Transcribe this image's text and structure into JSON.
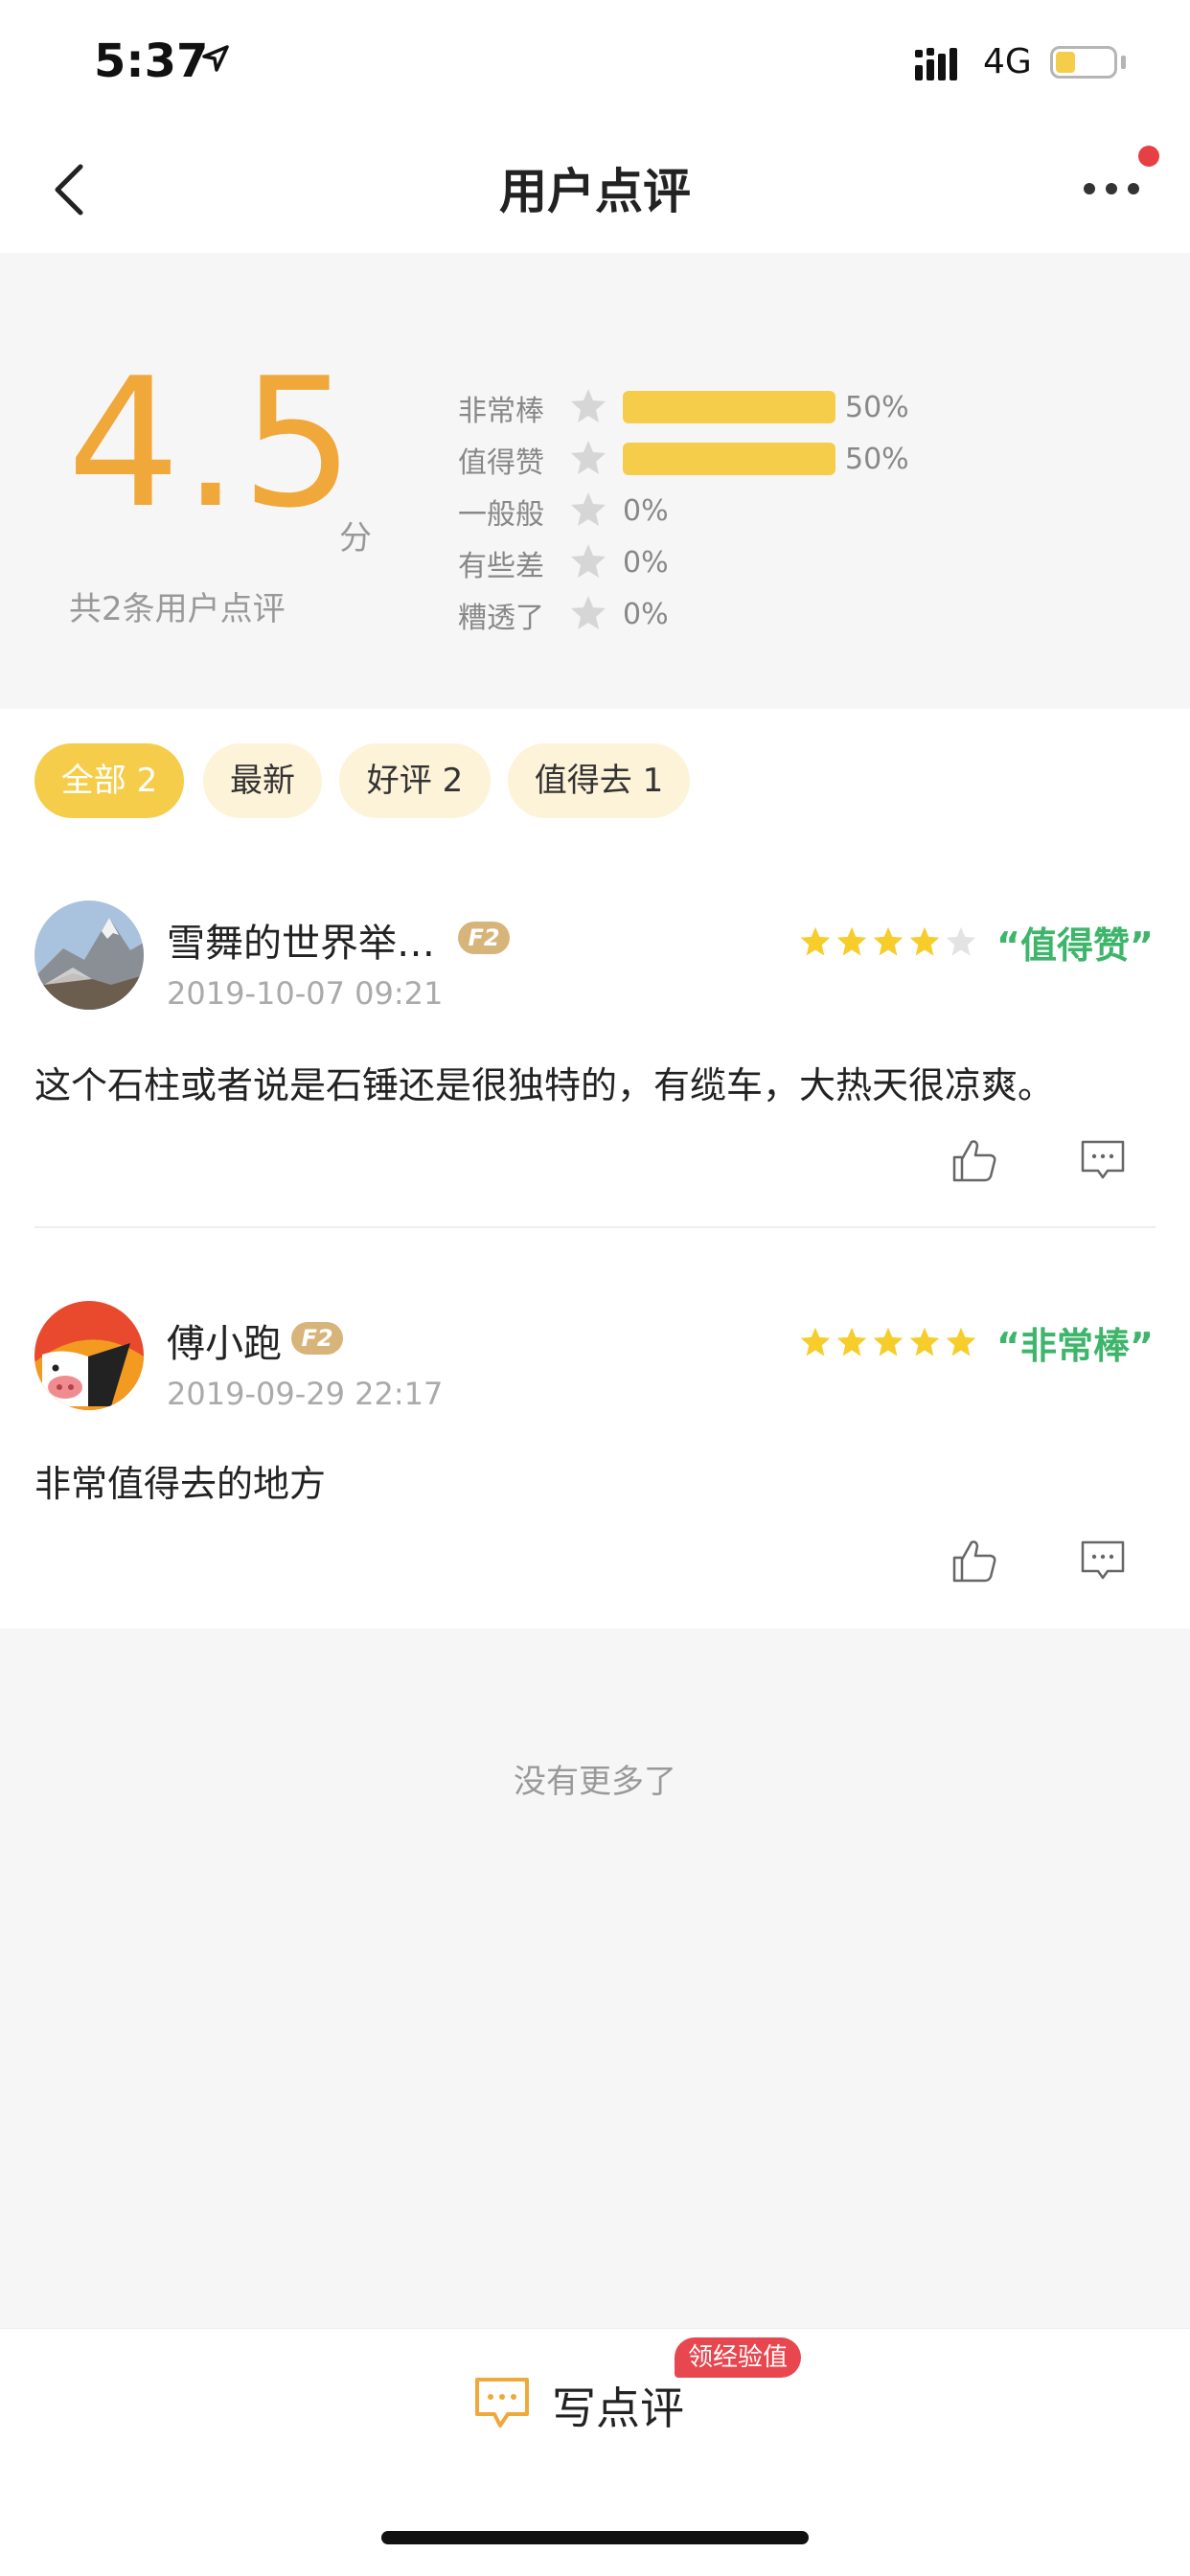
{
  "status_bar": {
    "time": "5:37",
    "network": "4G",
    "battery_level": 0.35
  },
  "nav": {
    "title": "用户点评",
    "has_notification": true
  },
  "summary": {
    "score": "4.5",
    "score_unit": "分",
    "total_label": "共2条用户点评",
    "breakdown": [
      {
        "label": "非常棒",
        "percent": 50,
        "percent_label": "50%"
      },
      {
        "label": "值得赞",
        "percent": 50,
        "percent_label": "50%"
      },
      {
        "label": "一般般",
        "percent": 0,
        "percent_label": "0%"
      },
      {
        "label": "有些差",
        "percent": 0,
        "percent_label": "0%"
      },
      {
        "label": "糟透了",
        "percent": 0,
        "percent_label": "0%"
      }
    ]
  },
  "filters": [
    {
      "label": "全部 2",
      "active": true
    },
    {
      "label": "最新",
      "active": false
    },
    {
      "label": "好评 2",
      "active": false
    },
    {
      "label": "值得去 1",
      "active": false
    }
  ],
  "reviews": [
    {
      "username": "雪舞的世界举…",
      "level_badge": "F2",
      "date": "2019-10-07 09:21",
      "rating": 4,
      "verdict": "“值得赞”",
      "text": "这个石柱或者说是石锤还是很独特的，有缆车，大热天很凉爽。",
      "avatar": "mountain-photo-avatar"
    },
    {
      "username": "傅小跑",
      "level_badge": "F2",
      "date": "2019-09-29 22:17",
      "rating": 5,
      "verdict": "“非常棒”",
      "text": "非常值得去的地方",
      "avatar": "pig-mascot-avatar"
    }
  ],
  "footer_note": "没有更多了",
  "bottom_bar": {
    "write_label": "写点评",
    "exp_tag": "领经验值"
  },
  "colors": {
    "accent": "#f6cd4b",
    "score": "#f0a83a",
    "verdict": "#3db56a",
    "badge": "#d7b47a",
    "tag": "#e8474f"
  },
  "icons": [
    "location-arrow-icon",
    "signal-icon",
    "battery-icon",
    "back-chevron-icon",
    "more-dots-icon",
    "star-icon",
    "thumbs-up-icon",
    "comment-icon",
    "write-review-icon"
  ]
}
